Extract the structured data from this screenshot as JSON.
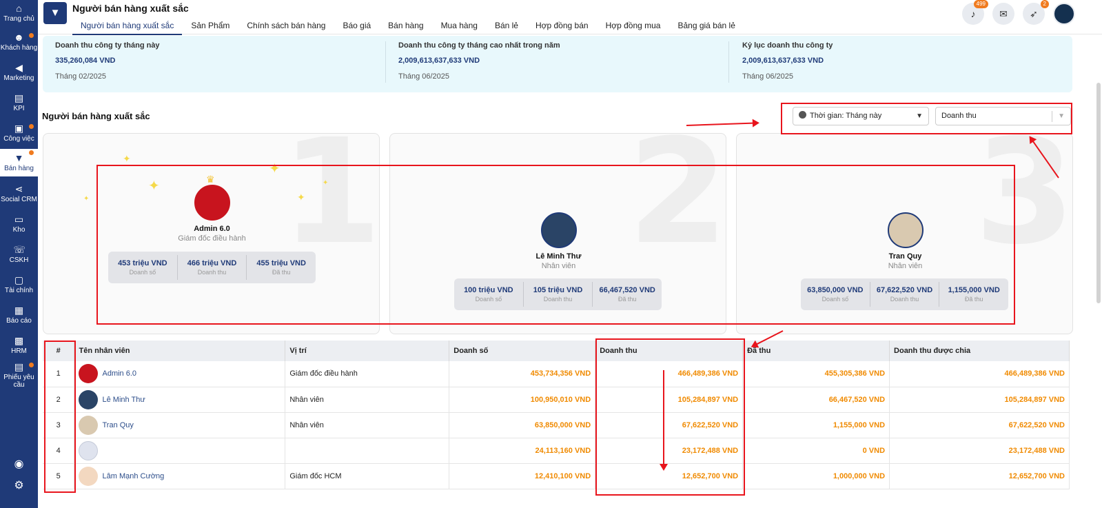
{
  "sidebar": {
    "items": [
      {
        "label": "Trang chủ",
        "icon": "home-icon",
        "glyph": "⌂",
        "dot": false
      },
      {
        "label": "Khách hàng",
        "icon": "users-icon",
        "glyph": "☻",
        "dot": true
      },
      {
        "label": "Marketing",
        "icon": "megaphone-icon",
        "glyph": "◀",
        "dot": false
      },
      {
        "label": "KPI",
        "icon": "chart-icon",
        "glyph": "▤",
        "dot": false
      },
      {
        "label": "Công việc",
        "icon": "briefcase-icon",
        "glyph": "▣",
        "dot": true
      },
      {
        "label": "Bán hàng",
        "icon": "cart-icon",
        "glyph": "🛒",
        "dot": true
      },
      {
        "label": "Social CRM",
        "icon": "share-icon",
        "glyph": "⋖",
        "dot": false
      },
      {
        "label": "Kho",
        "icon": "warehouse-icon",
        "glyph": "▭",
        "dot": false
      },
      {
        "label": "CSKH",
        "icon": "phone-icon",
        "glyph": "☏",
        "dot": false
      },
      {
        "label": "Tài chính",
        "icon": "finance-icon",
        "glyph": "▢",
        "dot": false
      },
      {
        "label": "Báo cáo",
        "icon": "report-icon",
        "glyph": "▦",
        "dot": false
      },
      {
        "label": "HRM",
        "icon": "id-card-icon",
        "glyph": "▩",
        "dot": false
      },
      {
        "label": "Phiếu yêu cầu",
        "icon": "request-icon",
        "glyph": "▤",
        "dot": true
      }
    ]
  },
  "header": {
    "title": "Người bán hàng xuất sắc",
    "tabs": [
      "Người bán hàng xuất sắc",
      "Sản Phẩm",
      "Chính sách bán hàng",
      "Báo giá",
      "Bán hàng",
      "Mua hàng",
      "Bán lẻ",
      "Hợp đồng bán",
      "Hợp đồng mua",
      "Bảng giá bán lẻ"
    ],
    "notif_count": "499",
    "rocket_count": "2"
  },
  "summary": [
    {
      "label": "Doanh thu công ty tháng này",
      "value": "335,260,084 VND",
      "month": "Tháng 02/2025"
    },
    {
      "label": "Doanh thu công ty tháng cao nhất trong năm",
      "value": "2,009,613,637,633 VND",
      "month": "Tháng 06/2025"
    },
    {
      "label": "Kỷ lục doanh thu công ty",
      "value": "2,009,613,637,633 VND",
      "month": "Tháng 06/2025"
    }
  ],
  "section_title": "Người bán hàng xuất sắc",
  "filters": {
    "time": "Thời gian: Tháng này",
    "metric": "Doanh thu"
  },
  "podium": [
    {
      "rank": "1",
      "name": "Admin 6.0",
      "role": "Giám đốc điều hành",
      "stats": [
        {
          "value": "453 triệu VND",
          "label": "Doanh số"
        },
        {
          "value": "466 triệu VND",
          "label": "Doanh thu"
        },
        {
          "value": "455 triệu VND",
          "label": "Đã thu"
        }
      ]
    },
    {
      "rank": "2",
      "name": "Lê Minh Thư",
      "role": "Nhân viên",
      "stats": [
        {
          "value": "100 triệu VND",
          "label": "Doanh số"
        },
        {
          "value": "105 triệu VND",
          "label": "Doanh thu"
        },
        {
          "value": "66,467,520 VND",
          "label": "Đã thu"
        }
      ]
    },
    {
      "rank": "3",
      "name": "Tran Quy",
      "role": "Nhân viên",
      "stats": [
        {
          "value": "63,850,000 VND",
          "label": "Doanh số"
        },
        {
          "value": "67,622,520 VND",
          "label": "Doanh thu"
        },
        {
          "value": "1,155,000 VND",
          "label": "Đã thu"
        }
      ]
    }
  ],
  "table": {
    "headers": [
      "#",
      "Tên nhân viên",
      "Vị trí",
      "Doanh số",
      "Doanh thu",
      "Đã thu",
      "Doanh thu được chia"
    ],
    "rows": [
      {
        "idx": "1",
        "name": "Admin 6.0",
        "position": "Giám đốc điều hành",
        "doanh_so": "453,734,356 VND",
        "doanh_thu": "466,489,386 VND",
        "da_thu": "455,305,386 VND",
        "duoc_chia": "466,489,386 VND"
      },
      {
        "idx": "2",
        "name": "Lê Minh Thư",
        "position": "Nhân viên",
        "doanh_so": "100,950,010 VND",
        "doanh_thu": "105,284,897 VND",
        "da_thu": "66,467,520 VND",
        "duoc_chia": "105,284,897 VND"
      },
      {
        "idx": "3",
        "name": "Tran Quy",
        "position": "Nhân viên",
        "doanh_so": "63,850,000 VND",
        "doanh_thu": "67,622,520 VND",
        "da_thu": "1,155,000 VND",
        "duoc_chia": "67,622,520 VND"
      },
      {
        "idx": "4",
        "name": "",
        "position": "",
        "doanh_so": "24,113,160 VND",
        "doanh_thu": "23,172,488 VND",
        "da_thu": "0 VND",
        "duoc_chia": "23,172,488 VND"
      },
      {
        "idx": "5",
        "name": "Lâm Mạnh Cường",
        "position": "Giám đốc HCM",
        "doanh_so": "12,410,100 VND",
        "doanh_thu": "12,652,700 VND",
        "da_thu": "1,000,000 VND",
        "duoc_chia": "12,652,700 VND"
      }
    ]
  },
  "colors": {
    "primary": "#1f3a78",
    "accent": "#f07b1f",
    "amount": "#f08a00",
    "annotation": "#e8141c"
  }
}
